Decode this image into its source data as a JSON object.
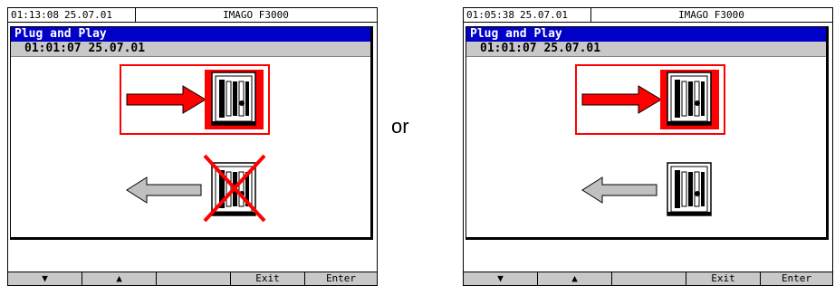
{
  "left_screen": {
    "status": {
      "time": "01:13:08",
      "date": "25.07.01",
      "model": "IMAGO F3000"
    },
    "dialog": {
      "title": "Plug and Play",
      "datetime": "01:01:07 25.07.01"
    },
    "insert_card": {
      "highlighted": true
    },
    "remove_card": {
      "crossed_out": true
    },
    "softkeys": {
      "down": "▼",
      "up": "▲",
      "blank": "",
      "exit": "Exit",
      "enter": "Enter"
    }
  },
  "separator": {
    "label": "or"
  },
  "right_screen": {
    "status": {
      "time": "01:05:38",
      "date": "25.07.01",
      "model": "IMAGO F3000"
    },
    "dialog": {
      "title": "Plug and Play",
      "datetime": "01:01:07 25.07.01"
    },
    "insert_card": {
      "highlighted": true
    },
    "remove_card": {
      "crossed_out": false
    },
    "softkeys": {
      "down": "▼",
      "up": "▲",
      "blank": "",
      "exit": "Exit",
      "enter": "Enter"
    }
  },
  "colors": {
    "title_bar": "#0000c8",
    "highlight": "#ff0000",
    "arrow_insert": "#ff0000",
    "arrow_remove": "#c0c0c0",
    "softkey_bar": "#c8c8c8"
  },
  "icons": [
    "arrow-right-icon",
    "arrow-left-icon",
    "memory-card-icon",
    "cross-icon",
    "triangle-down-icon",
    "triangle-up-icon"
  ]
}
